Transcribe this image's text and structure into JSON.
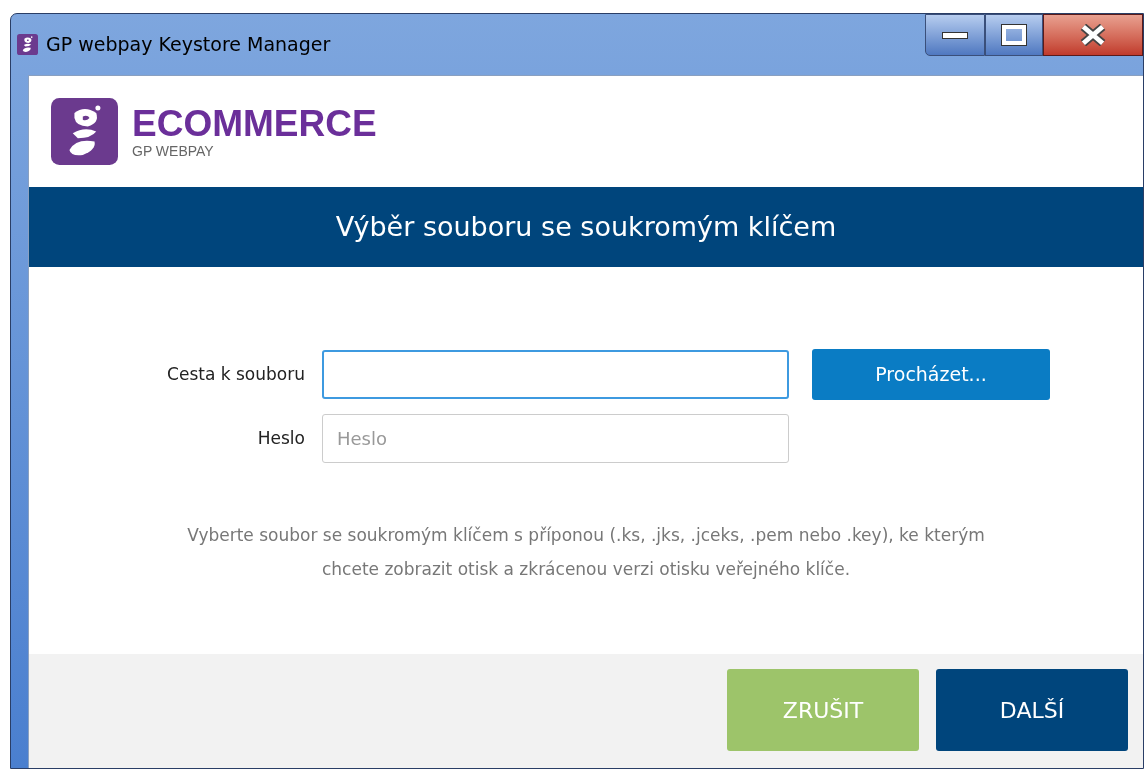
{
  "window": {
    "title": "GP webpay Keystore Manager"
  },
  "brand": {
    "name": "ECOMMERCE",
    "subtitle": "GP WEBPAY"
  },
  "banner": {
    "title": "Výběr souboru se soukromým klíčem"
  },
  "form": {
    "fields": [
      {
        "label": "Cesta k souboru",
        "focused": true
      },
      {
        "label": "Heslo",
        "placeholder": "Heslo",
        "focused": false
      }
    ],
    "browse_button": "Procházet...",
    "hint": "Vyberte soubor se soukromým klíčem s příponou (.ks, .jks, .jceks, .pem nebo .key), ke kterým chcete zobrazit otisk a zkrácenou verzi otisku veřejného klíče."
  },
  "footer": {
    "buttons": [
      {
        "label": "ZRUŠIT",
        "kind": "cancel"
      },
      {
        "label": "DALŠÍ",
        "kind": "next"
      }
    ]
  }
}
